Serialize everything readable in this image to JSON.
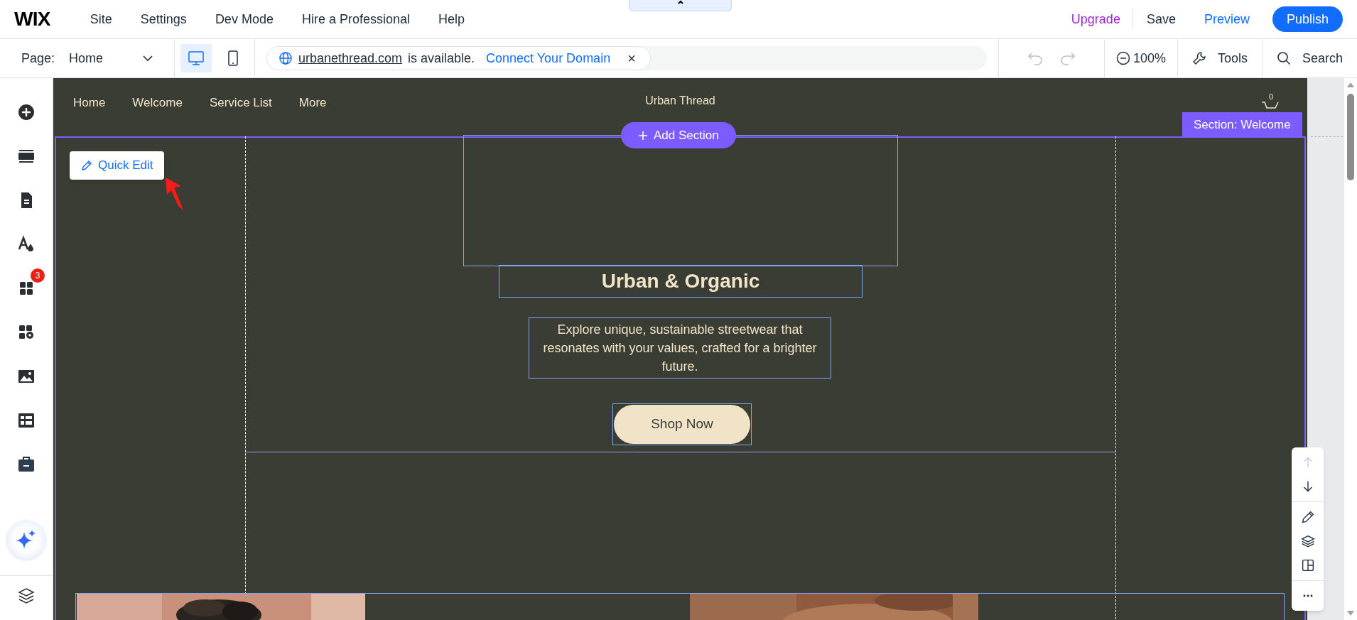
{
  "top_bar": {
    "logo": "WIX",
    "menu": [
      "Site",
      "Settings",
      "Dev Mode",
      "Hire a Professional",
      "Help"
    ],
    "upgrade": "Upgrade",
    "save": "Save",
    "preview": "Preview",
    "publish": "Publish"
  },
  "toolbar": {
    "page_label": "Page:",
    "page_value": "Home",
    "devices": [
      {
        "kind": "desktop",
        "selected": true
      },
      {
        "kind": "mobile",
        "selected": false
      }
    ],
    "domain": {
      "name": "urbanethread.com",
      "text": "is available.",
      "link": "Connect Your Domain",
      "close": "×"
    },
    "undo": {
      "disabled": true
    },
    "redo": {
      "disabled": true
    },
    "zoom": "100%",
    "tools": "Tools",
    "search": "Search"
  },
  "sidebar": {
    "items": [
      {
        "kind": "add"
      },
      {
        "kind": "sections"
      },
      {
        "kind": "pages"
      },
      {
        "kind": "theme"
      },
      {
        "kind": "apps",
        "badge": "3"
      },
      {
        "kind": "business"
      },
      {
        "kind": "media"
      },
      {
        "kind": "cms"
      },
      {
        "kind": "portfolio"
      },
      {
        "kind": "ai"
      },
      {
        "kind": "layers"
      }
    ]
  },
  "site": {
    "nav": [
      "Home",
      "Welcome",
      "Service List",
      "More"
    ],
    "title": "Urban Thread",
    "cart_count": "0",
    "section_label": "Section: Welcome",
    "add_section": "Add Section",
    "quick_edit": "Quick Edit",
    "heading": "Urban & Organic",
    "paragraph": "Explore unique, sustainable streetwear that resonates with your values, crafted for a brighter future.",
    "button": "Shop Now"
  },
  "float_toolbar": [
    {
      "kind": "up",
      "disabled": true
    },
    {
      "kind": "down",
      "disabled": false
    },
    {
      "kind": "edit",
      "disabled": false
    },
    {
      "kind": "layers",
      "disabled": false
    },
    {
      "kind": "layout",
      "disabled": false
    },
    {
      "kind": "more",
      "disabled": false
    }
  ]
}
